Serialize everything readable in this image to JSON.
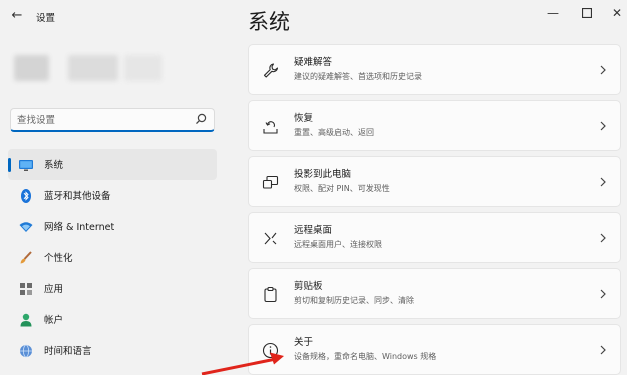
{
  "window": {
    "title": "设置"
  },
  "search": {
    "placeholder": "查找设置"
  },
  "nav": {
    "items": [
      {
        "label": "系统",
        "icon": "monitor-icon",
        "selected": true
      },
      {
        "label": "蓝牙和其他设备",
        "icon": "bluetooth-icon"
      },
      {
        "label": "网络 & Internet",
        "icon": "wifi-icon"
      },
      {
        "label": "个性化",
        "icon": "brush-icon"
      },
      {
        "label": "应用",
        "icon": "apps-icon"
      },
      {
        "label": "帐户",
        "icon": "person-icon"
      },
      {
        "label": "时间和语言",
        "icon": "globe-clock-icon"
      }
    ]
  },
  "main": {
    "title": "系统",
    "cards": [
      {
        "title": "疑难解答",
        "subtitle": "建议的疑难解答、首选项和历史记录",
        "icon": "wrench-icon"
      },
      {
        "title": "恢复",
        "subtitle": "重置、高级启动、返回",
        "icon": "recovery-icon"
      },
      {
        "title": "投影到此电脑",
        "subtitle": "权限、配对 PIN、可发现性",
        "icon": "project-icon"
      },
      {
        "title": "远程桌面",
        "subtitle": "远程桌面用户、连接权限",
        "icon": "remote-desktop-icon"
      },
      {
        "title": "剪贴板",
        "subtitle": "剪切和复制历史记录、同步、清除",
        "icon": "clipboard-icon"
      },
      {
        "title": "关于",
        "subtitle": "设备规格，重命名电脑、Windows 规格",
        "icon": "info-icon"
      }
    ]
  },
  "colors": {
    "accent": "#0067c0",
    "annotation_arrow": "#e0241b"
  }
}
